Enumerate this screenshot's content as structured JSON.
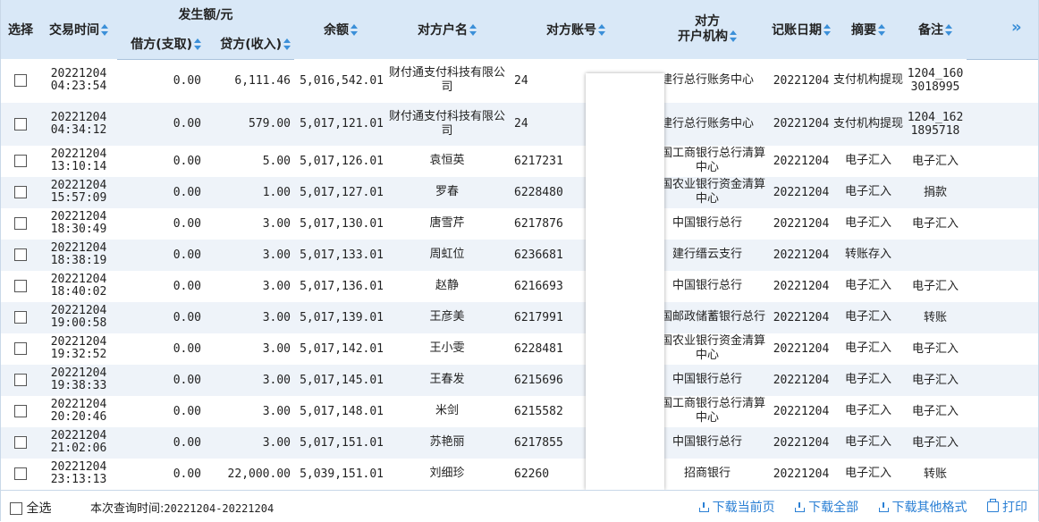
{
  "header": {
    "select": "选择",
    "time": "交易时间",
    "amount_group": "发生额/元",
    "debit": "借方(支取)",
    "credit": "贷方(收入)",
    "balance": "余额",
    "party_name": "对方户名",
    "party_account": "对方账号",
    "party_bank_l1": "对方",
    "party_bank_l2": "开户机构",
    "post_date": "记账日期",
    "summary": "摘要",
    "remark": "备注",
    "expand": "»"
  },
  "rows": [
    {
      "date": "20221204",
      "time": "04:23:54",
      "debit": "0.00",
      "credit": "6,111.46",
      "balance": "5,016,542.01",
      "name": "财付通支付科技有限公司",
      "account": "24",
      "bank": "建行总行账务中心",
      "post": "20221204",
      "summary": "支付机构提现",
      "remark": "1204_1603018995"
    },
    {
      "date": "20221204",
      "time": "04:34:12",
      "debit": "0.00",
      "credit": "579.00",
      "balance": "5,017,121.01",
      "name": "财付通支付科技有限公司",
      "account": "24",
      "bank": "建行总行账务中心",
      "post": "20221204",
      "summary": "支付机构提现",
      "remark": "1204_1621895718"
    },
    {
      "date": "20221204",
      "time": "13:10:14",
      "debit": "0.00",
      "credit": "5.00",
      "balance": "5,017,126.01",
      "name": "袁恒英",
      "account": "6217231",
      "bank": "中国工商银行总行清算中心",
      "post": "20221204",
      "summary": "电子汇入",
      "remark": "电子汇入"
    },
    {
      "date": "20221204",
      "time": "15:57:09",
      "debit": "0.00",
      "credit": "1.00",
      "balance": "5,017,127.01",
      "name": "罗春",
      "account": "6228480",
      "bank": "中国农业银行资金清算中心",
      "post": "20221204",
      "summary": "电子汇入",
      "remark": "捐款"
    },
    {
      "date": "20221204",
      "time": "18:30:49",
      "debit": "0.00",
      "credit": "3.00",
      "balance": "5,017,130.01",
      "name": "唐雪芹",
      "account": "6217876",
      "bank": "中国银行总行",
      "post": "20221204",
      "summary": "电子汇入",
      "remark": "电子汇入"
    },
    {
      "date": "20221204",
      "time": "18:38:19",
      "debit": "0.00",
      "credit": "3.00",
      "balance": "5,017,133.01",
      "name": "周虹位",
      "account": "6236681",
      "bank": "建行缙云支行",
      "post": "20221204",
      "summary": "转账存入",
      "remark": ""
    },
    {
      "date": "20221204",
      "time": "18:40:02",
      "debit": "0.00",
      "credit": "3.00",
      "balance": "5,017,136.01",
      "name": "赵静",
      "account": "6216693",
      "bank": "中国银行总行",
      "post": "20221204",
      "summary": "电子汇入",
      "remark": "电子汇入"
    },
    {
      "date": "20221204",
      "time": "19:00:58",
      "debit": "0.00",
      "credit": "3.00",
      "balance": "5,017,139.01",
      "name": "王彦美",
      "account": "6217991",
      "bank": "中国邮政储蓄银行总行",
      "post": "20221204",
      "summary": "电子汇入",
      "remark": "转账"
    },
    {
      "date": "20221204",
      "time": "19:32:52",
      "debit": "0.00",
      "credit": "3.00",
      "balance": "5,017,142.01",
      "name": "王小雯",
      "account": "6228481",
      "bank": "中国农业银行资金清算中心",
      "post": "20221204",
      "summary": "电子汇入",
      "remark": "电子汇入"
    },
    {
      "date": "20221204",
      "time": "19:38:33",
      "debit": "0.00",
      "credit": "3.00",
      "balance": "5,017,145.01",
      "name": "王春发",
      "account": "6215696",
      "bank": "中国银行总行",
      "post": "20221204",
      "summary": "电子汇入",
      "remark": "电子汇入"
    },
    {
      "date": "20221204",
      "time": "20:20:46",
      "debit": "0.00",
      "credit": "3.00",
      "balance": "5,017,148.01",
      "name": "米剑",
      "account": "6215582",
      "bank": "中国工商银行总行清算中心",
      "post": "20221204",
      "summary": "电子汇入",
      "remark": "电子汇入"
    },
    {
      "date": "20221204",
      "time": "21:02:06",
      "debit": "0.00",
      "credit": "3.00",
      "balance": "5,017,151.01",
      "name": "苏艳丽",
      "account": "6217855",
      "bank": "中国银行总行",
      "post": "20221204",
      "summary": "电子汇入",
      "remark": "电子汇入"
    },
    {
      "date": "20221204",
      "time": "23:13:13",
      "debit": "0.00",
      "credit": "22,000.00",
      "balance": "5,039,151.01",
      "name": "刘细珍",
      "account": "62260",
      "bank": "招商银行",
      "post": "20221204",
      "summary": "电子汇入",
      "remark": "转账"
    }
  ],
  "footer": {
    "select_all": "全选",
    "query_label": "本次查询时间:",
    "query_range": "20221204-20221204",
    "download_page": "下载当前页",
    "download_all": "下载全部",
    "download_other": "下载其他格式",
    "print": "打印"
  }
}
